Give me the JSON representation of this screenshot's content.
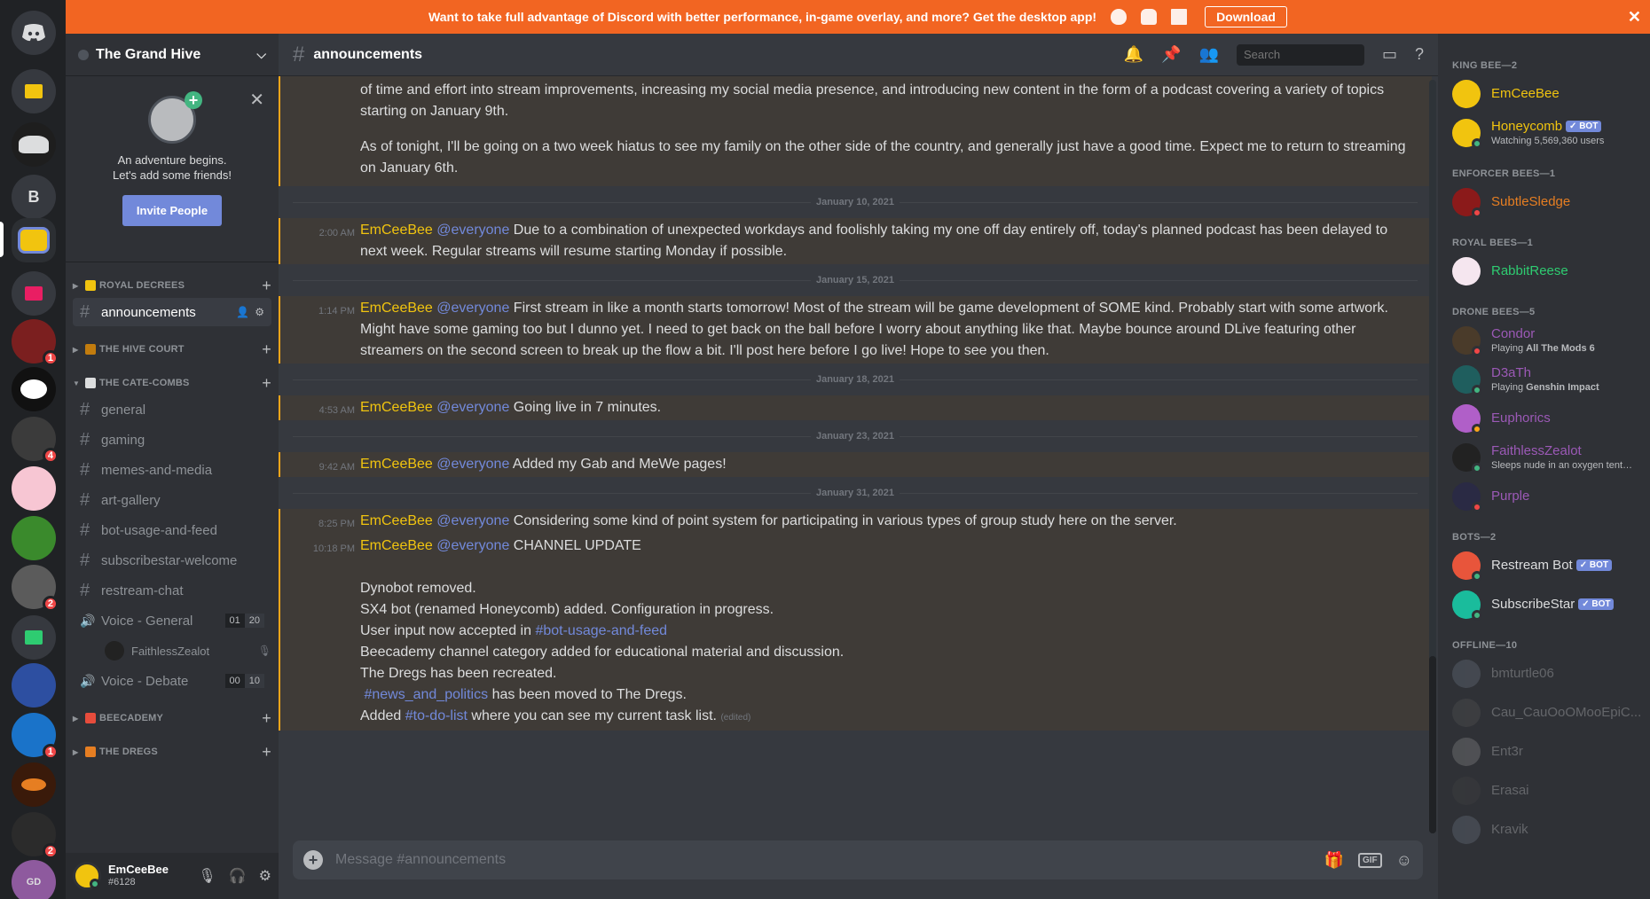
{
  "banner": {
    "text": "Want to take full advantage of Discord with better performance, in-game overlay, and more? Get the desktop app!",
    "download_label": "Download",
    "close": "✕"
  },
  "servers": [
    {
      "label": "",
      "badge": ""
    },
    {
      "label": "",
      "badge": ""
    },
    {
      "label": "",
      "badge": ""
    },
    {
      "label": "B",
      "badge": ""
    },
    {
      "label": "",
      "badge": ""
    },
    {
      "label": "",
      "badge": ""
    },
    {
      "label": "",
      "badge": "1"
    },
    {
      "label": "",
      "badge": ""
    },
    {
      "label": "",
      "badge": "4"
    },
    {
      "label": "",
      "badge": ""
    },
    {
      "label": "",
      "badge": ""
    },
    {
      "label": "",
      "badge": "2"
    },
    {
      "label": "",
      "badge": ""
    },
    {
      "label": "",
      "badge": ""
    },
    {
      "label": "",
      "badge": "1"
    },
    {
      "label": "",
      "badge": ""
    },
    {
      "label": "",
      "badge": "2"
    },
    {
      "label": "GD",
      "badge": ""
    }
  ],
  "guild": {
    "name": "The Grand Hive"
  },
  "friends_card": {
    "text": "An adventure begins.\nLet's add some friends!",
    "invite_label": "Invite People"
  },
  "categories": {
    "royal": "ROYAL DECREES",
    "court": "THE HIVE COURT",
    "cate": "THE CATE-COMBS",
    "beecademy": "BEECADEMY",
    "dregs": "THE DREGS"
  },
  "channels": {
    "announcements": "announcements",
    "general": "general",
    "gaming": "gaming",
    "memes": "memes-and-media",
    "art": "art-gallery",
    "bot": "bot-usage-and-feed",
    "subscribestar": "subscribestar-welcome",
    "restream": "restream-chat",
    "voice_general": "Voice - General",
    "voice_general_count": [
      "01",
      "20"
    ],
    "voice_user": "FaithlessZealot",
    "voice_debate": "Voice - Debate",
    "voice_debate_count": [
      "00",
      "10"
    ]
  },
  "user_panel": {
    "name": "EmCeeBee",
    "tag": "#6128"
  },
  "chat": {
    "channel": "announcements",
    "search_placeholder": "Search",
    "input_placeholder": "Message #announcements",
    "top_message": {
      "line1": "of time and effort into stream improvements, increasing my social media presence, and introducing new content in the form of a podcast covering a variety of topics starting on January 9th.",
      "line2": "As of tonight, I'll be going on a two week hiatus to see my family on the other side of the country, and generally just have a good time. Expect me to return to streaming on January 6th."
    },
    "dates": [
      "January 10, 2021",
      "January 15, 2021",
      "January 18, 2021",
      "January 23, 2021",
      "January 31, 2021"
    ],
    "messages": [
      {
        "time": "2:00 AM",
        "author": "EmCeeBee",
        "mention": "@everyone",
        "text": "Due to a combination of unexpected workdays and foolishly taking my one off day entirely off, today's planned podcast has been delayed to next week. Regular streams will resume starting Monday if possible."
      },
      {
        "time": "1:14 PM",
        "author": "EmCeeBee",
        "mention": "@everyone",
        "text": "First stream in like a month starts tomorrow! Most of the stream will be game development of SOME kind. Probably start with some artwork. Might have some gaming too but I dunno yet. I need to get back on the ball before I worry about anything like that. Maybe bounce around DLive featuring other streamers on the second screen to break up the flow a bit. I'll post here before I go live! Hope to see you then."
      },
      {
        "time": "4:53 AM",
        "author": "EmCeeBee",
        "mention": "@everyone",
        "text": "Going live in 7 minutes."
      },
      {
        "time": "9:42 AM",
        "author": "EmCeeBee",
        "mention": "@everyone",
        "text": "Added my Gab and MeWe pages!"
      },
      {
        "time": "8:25 PM",
        "author": "EmCeeBee",
        "mention": "@everyone",
        "text": "Considering some kind of point system for participating in various types of group study here on the server."
      },
      {
        "time": "10:18 PM",
        "author": "EmCeeBee",
        "mention": "@everyone",
        "text": "CHANNEL UPDATE"
      }
    ],
    "update_lines": {
      "l1": "Dynobot removed.",
      "l2": "SX4 bot (renamed Honeycomb) added. Configuration in progress.",
      "l3a": "User input now accepted in",
      "l3link": "#bot-usage-and-feed",
      "l4": "Beecademy channel category added for educational material and discussion.",
      "l5": "The Dregs has been recreated.",
      "l6link": "#news_and_politics",
      "l6b": "has been moved to The Dregs.",
      "l7a": "Added",
      "l7link": "#to-do-list",
      "l7b": "where you can see my current task list.",
      "edited": "(edited)"
    }
  },
  "members": {
    "groups": {
      "king": "KING BEE—2",
      "enforcer": "ENFORCER BEES—1",
      "royal": "ROYAL BEES—1",
      "drone": "DRONE BEES—5",
      "bots": "BOTS—2",
      "offline": "OFFLINE—10"
    },
    "bot_tag": "✓ BOT",
    "list": {
      "emceebee": "EmCeeBee",
      "honeycomb": "Honeycomb",
      "honeycomb_act": "Watching 5,569,360 users",
      "subtle": "SubtleSledge",
      "rabbit": "RabbitReese",
      "condor": "Condor",
      "condor_act_a": "Playing",
      "condor_act_b": "All The Mods 6",
      "d3ath": "D3aTh",
      "d3ath_act_a": "Playing",
      "d3ath_act_b": "Genshin Impact",
      "euphorics": "Euphorics",
      "faithless": "FaithlessZealot",
      "faithless_act": "Sleeps nude in an oxygen tent ...",
      "purple": "Purple",
      "restream": "Restream Bot",
      "subscribestar": "SubscribeStar",
      "off1": "bmturtle06",
      "off2": "Cau_CauOoOMooEpiC...",
      "off3": "Ent3r",
      "off4": "Erasai",
      "off5": "Kravik"
    }
  },
  "colors": {
    "banner": "#f26522",
    "accent": "#7289da",
    "author": "#f1c40f",
    "king": "#f1c40f",
    "enforcer": "#e67e22",
    "royal": "#2ecc71",
    "drone": "#9b59b6"
  }
}
